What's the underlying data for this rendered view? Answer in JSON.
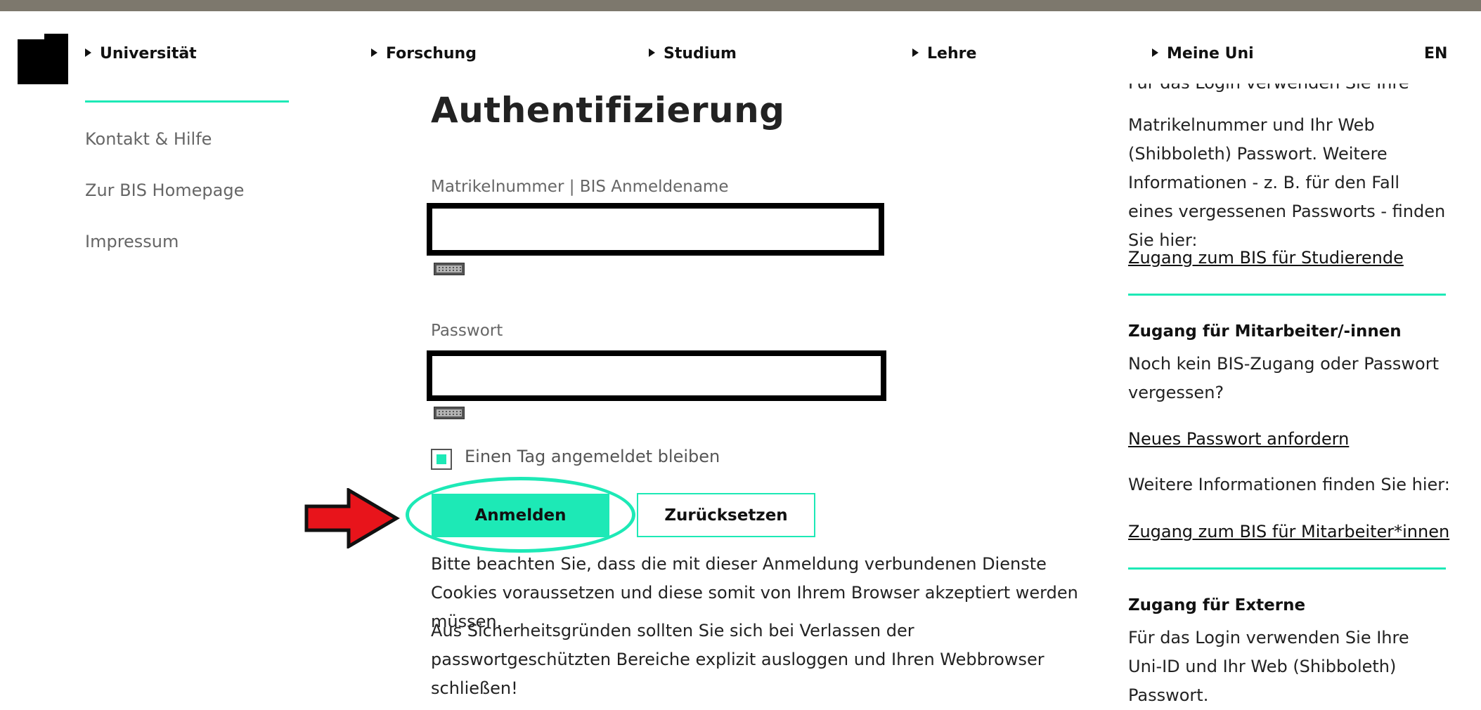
{
  "nav": {
    "items": [
      "Universität",
      "Forschung",
      "Studium",
      "Lehre",
      "Meine Uni"
    ],
    "lang": "EN"
  },
  "sidebar": {
    "links": [
      "Kontakt & Hilfe",
      "Zur BIS Homepage",
      "Impressum"
    ]
  },
  "main": {
    "title": "Authentifizierung",
    "username_label": "Matrikelnummer | BIS Anmeldename",
    "username_value": "",
    "password_label": "Passwort",
    "password_value": "",
    "remember_label": "Einen Tag angemeldet bleiben",
    "remember_checked": true,
    "login_button": "Anmelden",
    "reset_button": "Zurücksetzen",
    "note1": "Bitte beachten Sie, dass die mit dieser Anmeldung verbundenen Dienste Cookies voraussetzen und diese somit von Ihrem Browser akzeptiert werden müssen.",
    "note2": "Aus Sicherheitsgründen sollten Sie sich bei Verlassen der passwortgeschützten Bereiche explizit ausloggen und Ihren Webbrowser schließen!"
  },
  "right": {
    "partial_top": "Für das Login verwenden Sie Ihre",
    "students_text": "Matrikelnummer und Ihr Web (Shibboleth) Passwort. Weitere Informationen - z. B. für den Fall eines vergessenen Passworts - finden Sie hier:",
    "students_link": "Zugang zum BIS für Studierende",
    "staff_heading": "Zugang für Mitarbeiter/-innen",
    "staff_text": "Noch kein BIS-Zugang oder Passwort vergessen?",
    "staff_link1": "Neues Passwort anfordern",
    "staff_more": "Weitere Informationen finden Sie hier:",
    "staff_link2": "Zugang zum BIS für Mitarbeiter*innen",
    "external_heading": "Zugang für Externe",
    "external_text": "Für das Login verwenden Sie Ihre Uni-ID und Ihr Web (Shibboleth) Passwort."
  },
  "colors": {
    "accent": "#1de9b6",
    "topbar": "#7d786d",
    "arrow": "#e8141b"
  }
}
